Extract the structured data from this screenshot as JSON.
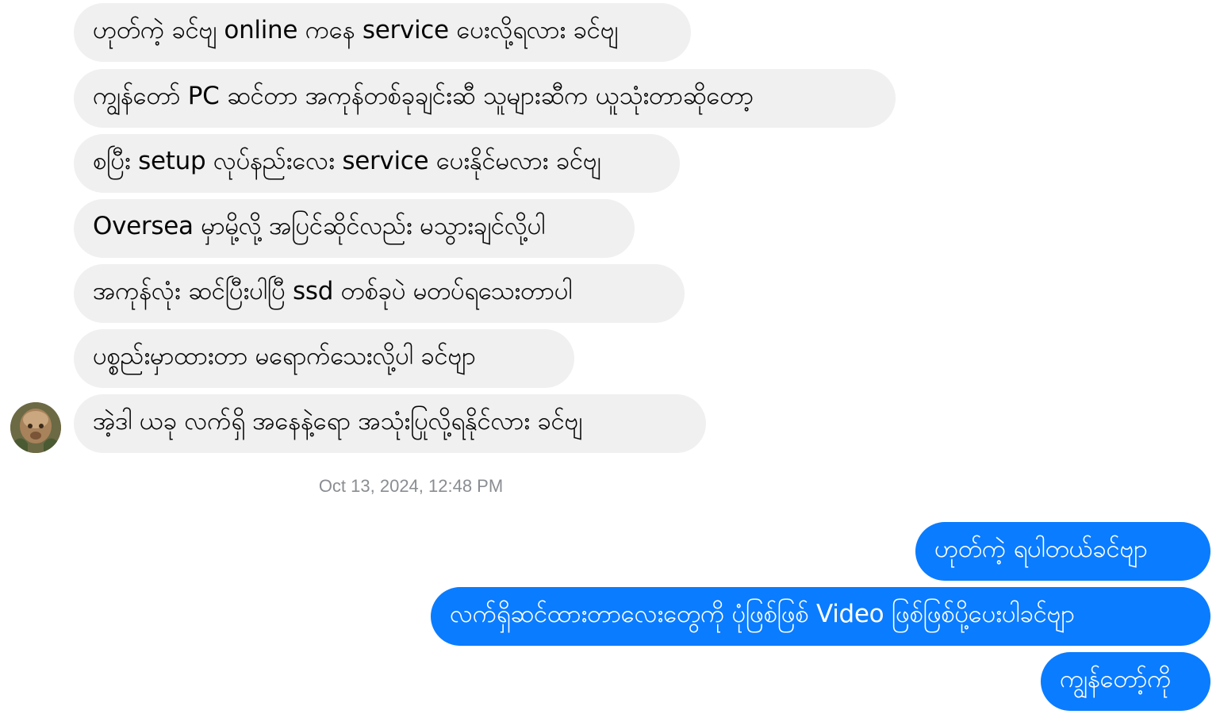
{
  "incoming_messages": [
    {
      "text": "ဟုတ်ကဲ့ ခင်ဗျ online ကနေ service ပေးလို့ရလား ခင်ဗျ"
    },
    {
      "text": "ကျွန်တော် PC ဆင်တာ အကုန်တစ်ခုချင်းဆီ သူများဆီက ယူသုံးတာဆိုတော့"
    },
    {
      "text": "စပြီး setup လုပ်နည်းလေး service ပေးနိုင်မလား ခင်ဗျ"
    },
    {
      "text": "Oversea မှာမို့လို့ အပြင်ဆိုင်လည်း မသွားချင်လို့ပါ"
    },
    {
      "text": "အကုန်လုံး ဆင်ပြီးပါပြီ ssd တစ်ခုပဲ မတပ်ရသေးတာပါ"
    },
    {
      "text": "ပစ္စည်းမှာထားတာ မရောက်သေးလို့ပါ ခင်ဗျာ"
    },
    {
      "text": "အဲ့ဒါ ယခု လက်ရှိ အနေနဲ့ရော အသုံးပြုလို့ရနိုင်လား ခင်ဗျ"
    }
  ],
  "timestamp": "Oct 13, 2024, 12:48 PM",
  "outgoing_messages": [
    {
      "text": "ဟုတ်ကဲ့ ရပါတယ်ခင်ဗျာ"
    },
    {
      "text": "လက်ရှိဆင်ထားတာလေးတွေကို ပုံဖြစ်ဖြစ် Video ဖြစ်ဖြစ်ပို့ပေးပါခင်ဗျာ"
    },
    {
      "text": "ကျွန်တော့်ကို"
    }
  ],
  "colors": {
    "incoming_bubble": "#f0f0f0",
    "outgoing_bubble": "#0a7cff",
    "timestamp_text": "#8a8d91"
  },
  "icons": {
    "avatar": "contact-avatar"
  }
}
